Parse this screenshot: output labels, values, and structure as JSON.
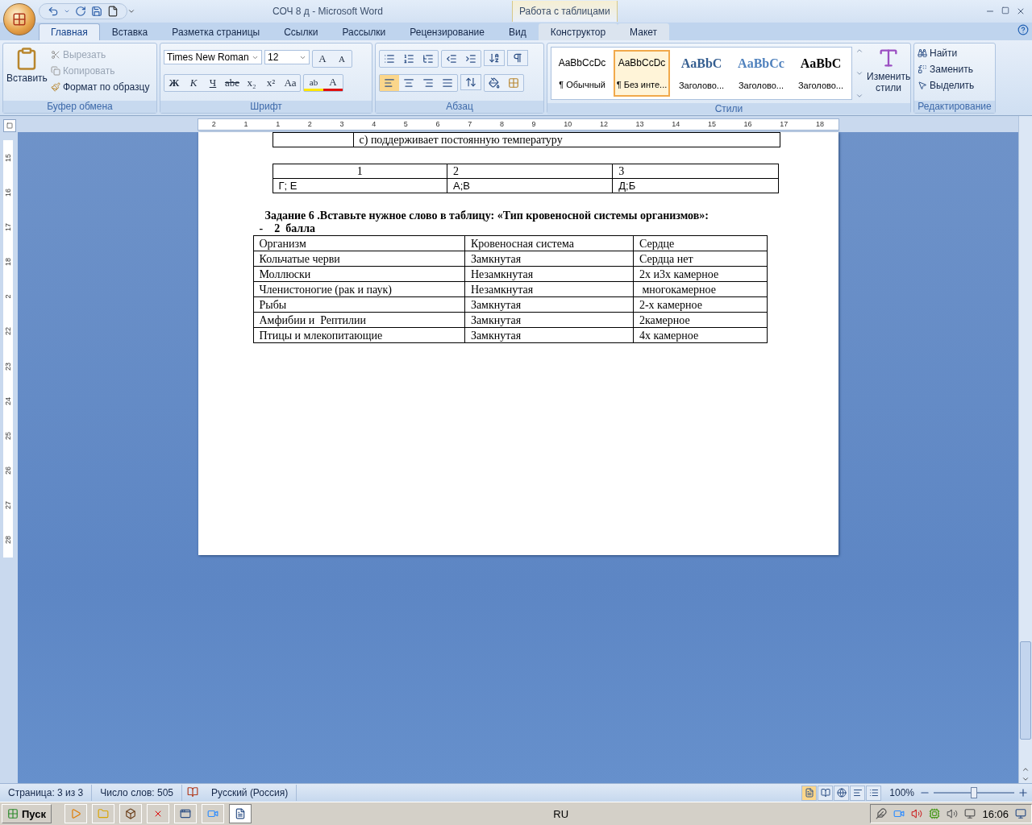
{
  "window": {
    "title": "СОЧ 8 д - Microsoft Word",
    "context_tab": "Работа с таблицами"
  },
  "tabs": [
    {
      "label": "Главная",
      "selected": true
    },
    {
      "label": "Вставка",
      "selected": false
    },
    {
      "label": "Разметка страницы",
      "selected": false
    },
    {
      "label": "Ссылки",
      "selected": false
    },
    {
      "label": "Рассылки",
      "selected": false
    },
    {
      "label": "Рецензирование",
      "selected": false
    },
    {
      "label": "Вид",
      "selected": false
    },
    {
      "label": "Конструктор",
      "selected": false
    },
    {
      "label": "Макет",
      "selected": false
    }
  ],
  "clipboard": {
    "paste": "Вставить",
    "cut": {
      "label": "Вырезать",
      "disabled": true
    },
    "copy": {
      "label": "Копировать",
      "disabled": true
    },
    "format": {
      "label": "Формат по образцу",
      "disabled": false
    },
    "group": "Буфер обмена"
  },
  "font": {
    "name": "Times New Roman",
    "size": "12",
    "grow": "A",
    "shrink": "A",
    "buttons": [
      {
        "label": "Ж",
        "kind": "bold"
      },
      {
        "label": "К",
        "kind": "italic"
      },
      {
        "label": "Ч",
        "kind": "underline"
      },
      {
        "label": "abe",
        "kind": "strike"
      },
      {
        "label": "x₂",
        "kind": "plain"
      },
      {
        "label": "x²",
        "kind": "plain"
      },
      {
        "label": "Aa",
        "kind": "plain"
      }
    ],
    "highlight": "ab",
    "font_color_label": "A",
    "group": "Шрифт"
  },
  "paragraph": {
    "align": [
      {
        "selected": true
      },
      {
        "selected": false
      },
      {
        "selected": false
      },
      {
        "selected": false
      }
    ],
    "group": "Абзац"
  },
  "styles": {
    "items": [
      {
        "preview": "AaBbCcDc",
        "name": "¶ Обычный",
        "kind": "normal",
        "selected": false
      },
      {
        "preview": "AaBbCcDc",
        "name": "¶ Без инте...",
        "kind": "normal",
        "selected": true
      },
      {
        "preview": "AaBbC",
        "name": "Заголово...",
        "kind": "heading1",
        "selected": false
      },
      {
        "preview": "AaBbCc",
        "name": "Заголово...",
        "kind": "heading2",
        "selected": false
      },
      {
        "preview": "AaBbC",
        "name": "Заголово...",
        "kind": "title",
        "selected": false
      }
    ],
    "change": "Изменить стили",
    "group": "Стили"
  },
  "editing": {
    "find": "Найти",
    "replace": "Заменить",
    "select": "Выделить",
    "group": "Редактирование"
  },
  "ruler": [
    "2",
    "1",
    "1",
    "2",
    "3",
    "4",
    "5",
    "6",
    "7",
    "8",
    "9",
    "10",
    "12",
    "13",
    "14",
    "15",
    "16",
    "17",
    "18"
  ],
  "vertical_ruler": [
    "15",
    "16",
    "17",
    "18",
    "2",
    "22",
    "23",
    "24",
    "25",
    "26",
    "27",
    "28"
  ],
  "document": {
    "partial_row": "с) поддерживает постоянную температуру",
    "answer_table": {
      "columns": [
        "1",
        "2",
        "3"
      ],
      "rows": [
        [
          "Г; Е",
          "А;В",
          "Д;Б"
        ]
      ]
    },
    "task": "Задание 6 .Вставьте нужное слово в таблицу: «Тип кровеносной системы организмов»:",
    "points": "-    2  балла",
    "table": {
      "columns": [
        "Организм",
        "Кровеносная система",
        "Сердце"
      ],
      "rows": [
        [
          "Кольчатые черви",
          "Замкнутая",
          "Сердца нет"
        ],
        [
          "Моллюски",
          "Незамкнутая",
          "2х и3х камерное"
        ],
        [
          "Членистоногие (рак и паук)",
          "Незамкнутая",
          " многокамерное"
        ],
        [
          "Рыбы",
          "Замкнутая",
          "2-х камерное"
        ],
        [
          "Амфибии и  Рептилии",
          "Замкнутая",
          "2камерное"
        ],
        [
          "Птицы и млекопитающие",
          "Замкнутая",
          "4х камерное"
        ]
      ]
    }
  },
  "status_bar": {
    "page": "Страница: 3 из 3",
    "words": "Число слов: 505",
    "language": "Русский (Россия)",
    "views": [
      {
        "selected": true
      },
      {
        "selected": false
      },
      {
        "selected": false
      },
      {
        "selected": false
      },
      {
        "selected": false
      }
    ],
    "zoom": "100%",
    "zoom_level": {
      "level": 0.5
    }
  },
  "taskbar": {
    "start": "Пуск",
    "language": "RU",
    "time": "16:06"
  }
}
